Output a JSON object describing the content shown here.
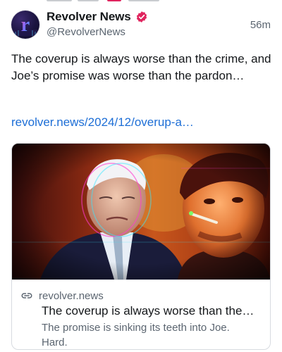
{
  "post": {
    "author": {
      "name": "Revolver News",
      "handle": "@RevolverNews",
      "avatar_letter": "r",
      "verified_badge_color": "#e0245e"
    },
    "time": "56m",
    "text": "The coverup is always worse than the crime, and Joe’s promise was worse than the pardon…",
    "link_text": "revolver.news/2024/12/overup-a…",
    "link_color": "#1d6ed6"
  },
  "card": {
    "domain": "revolver.news",
    "title": "The coverup is always worse than the…",
    "description": "The promise is sinking its teeth into Joe. Hard.",
    "icon": "link-icon"
  },
  "colors": {
    "text_primary": "#14171a",
    "text_secondary": "#5b6570",
    "border": "#d7dbe0"
  }
}
